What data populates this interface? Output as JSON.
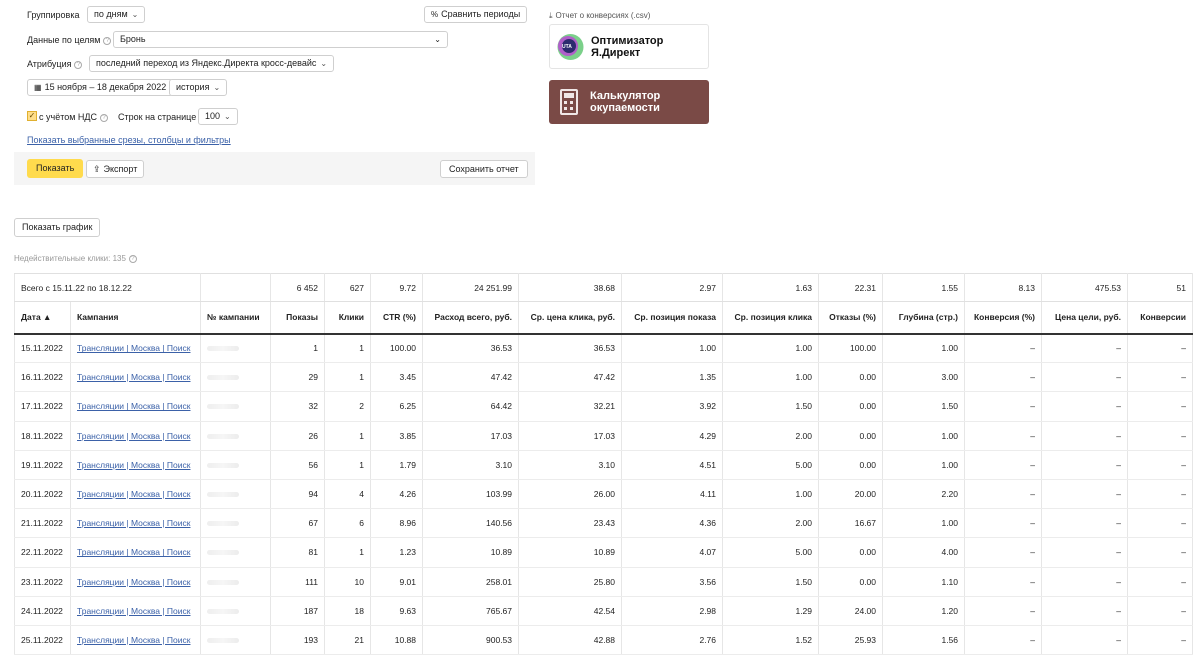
{
  "settings": {
    "grouping_label": "Группировка",
    "grouping_value": "по дням",
    "compare_button": "Сравнить периоды",
    "goals_label": "Данные по целям",
    "goals_value": "Бронь",
    "attribution_label": "Атрибуция",
    "attribution_value": "последний переход из Яндекс.Директа кросс-девайс",
    "date_range": "15 ноября – 18 декабря 2022",
    "history_button": "история",
    "vat_label": "с учётом НДС",
    "vat_checked": true,
    "rows_label": "Строк на странице",
    "rows_value": "100",
    "show_filters_link": "Показать выбранные срезы, столбцы и фильтры",
    "show_button": "Показать",
    "export_button": "Экспорт",
    "save_button": "Сохранить отчет"
  },
  "promo": {
    "csv_link": "Отчет о конверсиях (.csv)",
    "optimizer_line1": "Оптимизатор",
    "optimizer_line2": "Я.Директ",
    "logo_text": "UTA",
    "calc_line1": "Калькулятор",
    "calc_line2": "окупаемости",
    "calc_color": "#7a4a46"
  },
  "show_chart_button": "Показать график",
  "invalid_clicks": "Недействительные клики: 135",
  "table": {
    "total_label": "Всего с 15.11.22 по 18.12.22",
    "totals": [
      "",
      "",
      "6 452",
      "627",
      "9.72",
      "24 251.99",
      "38.68",
      "2.97",
      "1.63",
      "22.31",
      "1.55",
      "8.13",
      "475.53",
      "51"
    ],
    "headers": [
      "Дата ▲",
      "Кампания",
      "№ кампании",
      "Показы",
      "Клики",
      "CTR (%)",
      "Расход всего, руб.",
      "Ср. цена клика, руб.",
      "Ср. позиция показа",
      "Ср. позиция клика",
      "Отказы (%)",
      "Глубина (стр.)",
      "Конверсия (%)",
      "Цена цели, руб.",
      "Конверсии"
    ],
    "rows": [
      [
        "15.11.2022",
        "Трансляции | Москва | Поиск",
        "",
        "1",
        "1",
        "100.00",
        "36.53",
        "36.53",
        "1.00",
        "1.00",
        "100.00",
        "1.00",
        "–",
        "–",
        "–"
      ],
      [
        "16.11.2022",
        "Трансляции | Москва | Поиск",
        "",
        "29",
        "1",
        "3.45",
        "47.42",
        "47.42",
        "1.35",
        "1.00",
        "0.00",
        "3.00",
        "–",
        "–",
        "–"
      ],
      [
        "17.11.2022",
        "Трансляции | Москва | Поиск",
        "",
        "32",
        "2",
        "6.25",
        "64.42",
        "32.21",
        "3.92",
        "1.50",
        "0.00",
        "1.50",
        "–",
        "–",
        "–"
      ],
      [
        "18.11.2022",
        "Трансляции | Москва | Поиск",
        "",
        "26",
        "1",
        "3.85",
        "17.03",
        "17.03",
        "4.29",
        "2.00",
        "0.00",
        "1.00",
        "–",
        "–",
        "–"
      ],
      [
        "19.11.2022",
        "Трансляции | Москва | Поиск",
        "",
        "56",
        "1",
        "1.79",
        "3.10",
        "3.10",
        "4.51",
        "5.00",
        "0.00",
        "1.00",
        "–",
        "–",
        "–"
      ],
      [
        "20.11.2022",
        "Трансляции | Москва | Поиск",
        "",
        "94",
        "4",
        "4.26",
        "103.99",
        "26.00",
        "4.11",
        "1.00",
        "20.00",
        "2.20",
        "–",
        "–",
        "–"
      ],
      [
        "21.11.2022",
        "Трансляции | Москва | Поиск",
        "",
        "67",
        "6",
        "8.96",
        "140.56",
        "23.43",
        "4.36",
        "2.00",
        "16.67",
        "1.00",
        "–",
        "–",
        "–"
      ],
      [
        "22.11.2022",
        "Трансляции | Москва | Поиск",
        "",
        "81",
        "1",
        "1.23",
        "10.89",
        "10.89",
        "4.07",
        "5.00",
        "0.00",
        "4.00",
        "–",
        "–",
        "–"
      ],
      [
        "23.11.2022",
        "Трансляции | Москва | Поиск",
        "",
        "111",
        "10",
        "9.01",
        "258.01",
        "25.80",
        "3.56",
        "1.50",
        "0.00",
        "1.10",
        "–",
        "–",
        "–"
      ],
      [
        "24.11.2022",
        "Трансляции | Москва | Поиск",
        "",
        "187",
        "18",
        "9.63",
        "765.67",
        "42.54",
        "2.98",
        "1.29",
        "24.00",
        "1.20",
        "–",
        "–",
        "–"
      ],
      [
        "25.11.2022",
        "Трансляции | Москва | Поиск",
        "",
        "193",
        "21",
        "10.88",
        "900.53",
        "42.88",
        "2.76",
        "1.52",
        "25.93",
        "1.56",
        "–",
        "–",
        "–"
      ]
    ]
  }
}
